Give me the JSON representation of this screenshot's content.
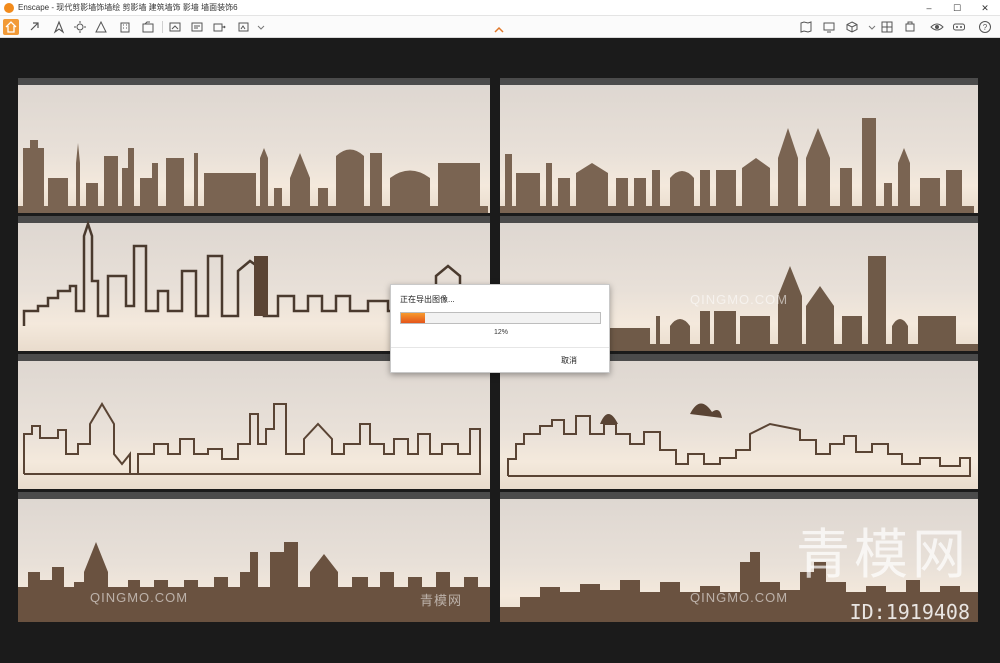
{
  "window": {
    "app_name": "Enscape",
    "title": "Enscape - 现代剪影墙饰墙绘 剪影墙 建筑墙饰 影墙 墙面装饰6",
    "minimize_icon": "minimize-icon",
    "maximize_icon": "maximize-icon",
    "close_icon": "close-icon"
  },
  "toolbar": {
    "left_icons": [
      "home-icon",
      "link-icon",
      "navigation-icon",
      "sun-icon",
      "view-icon",
      "screenshot-icon",
      "building-icon",
      "video-icon",
      "export-icon",
      "panorama-icon",
      "batch-icon",
      "settings-icon"
    ],
    "right_icons": [
      "map-icon",
      "display-icon",
      "cube-icon",
      "window-icon",
      "asset-icon",
      "eye-icon",
      "vr-icon",
      "help-icon"
    ],
    "accent": "#f29a37"
  },
  "dialog": {
    "title": "正在导出图像...",
    "progress_percent": 12,
    "progress_label": "12%",
    "cancel_label": "取消"
  },
  "watermarks": {
    "pinyin": "QINGMO.COM",
    "cn_small": "青模网",
    "cn_big": "青模网",
    "id": "ID:1919408"
  }
}
